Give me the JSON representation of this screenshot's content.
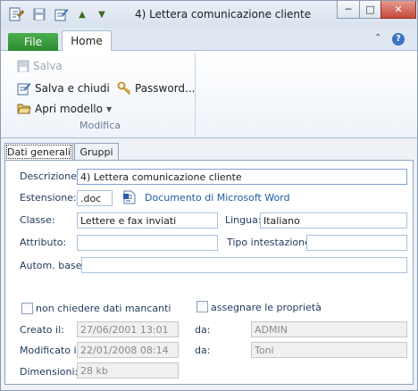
{
  "window": {
    "title": "4) Lettera comunicazione cliente",
    "minimize": "─",
    "maximize": "□",
    "close": "✕"
  },
  "quick_access": {
    "move_up": "▲",
    "move_down": "▼"
  },
  "ribbon": {
    "tabs": {
      "file": "File",
      "home": "Home"
    },
    "help": "?",
    "collapse": "⌃",
    "group_label": "Modifica",
    "buttons": {
      "save": "Salva",
      "save_close": "Salva e chiudi",
      "password": "Password...",
      "open_model": "Apri modello"
    }
  },
  "doc_tabs": {
    "general": "Dati generali",
    "groups": "Gruppi"
  },
  "form": {
    "descrizione_label": "Descrizione:",
    "descrizione_value": "4) Lettera comunicazione cliente",
    "estensione_label": "Estensione:",
    "estensione_value": ".doc",
    "file_type_link": "Documento di Microsoft Word",
    "classe_label": "Classe:",
    "classe_value": "Lettere e fax inviati",
    "lingua_label": "Lingua:",
    "lingua_value": "Italiano",
    "attributo_label": "Attributo:",
    "attributo_value": "",
    "tipo_label": "Tipo intestazione:",
    "tipo_value": "",
    "autom_label": "Autom. base:",
    "autom_value": "",
    "non_chiedere_label": "non chiedere dati mancanti",
    "assegnare_label": "assegnare le proprietà",
    "creato_label": "Creato il:",
    "creato_value": "27/06/2001 13:01",
    "creato_da_label": "da:",
    "creato_da_value": "ADMIN",
    "modificato_label": "Modificato il:",
    "modificato_value": "22/01/2008 08:14",
    "modificato_da_label": "da:",
    "modificato_da_value": "Toni",
    "dimensioni_label": "Dimensioni:",
    "dimensioni_value": "28 kb"
  }
}
